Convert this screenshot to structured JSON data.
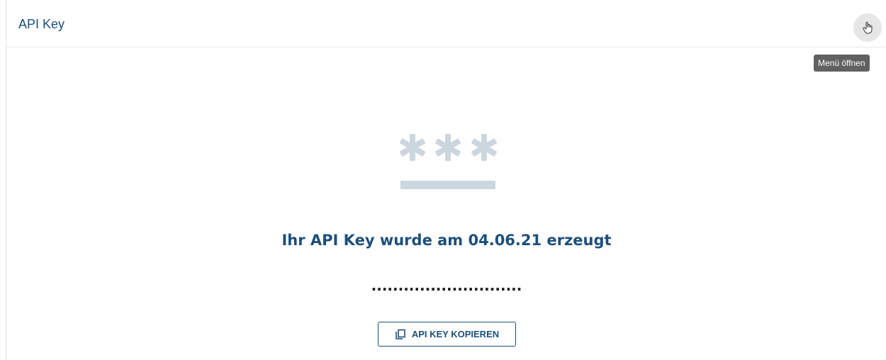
{
  "header": {
    "title": "API Key",
    "menu_button_icon": "hand-pointer-icon",
    "menu_tooltip": "Menü öffnen"
  },
  "main": {
    "illustration": "password-asterisks-icon",
    "message": "Ihr API Key wurde am 04.06.21 erzeugt",
    "masked_key": "............................",
    "copy_button": {
      "label": "API KEY KOPIEREN",
      "icon": "copy-icon"
    }
  },
  "colors": {
    "primary": "#1c4f7c",
    "illustration": "#cbd6df",
    "tooltip_bg": "#616161"
  }
}
